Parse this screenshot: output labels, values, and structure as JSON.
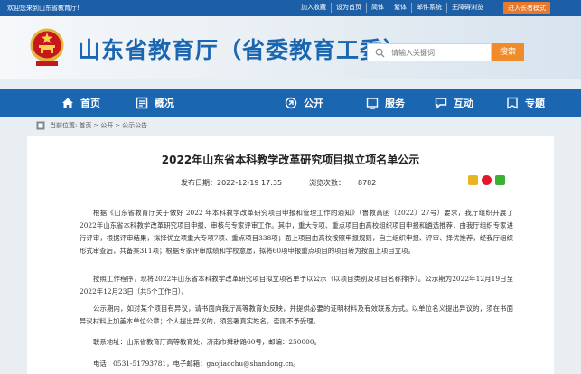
{
  "topbar": {
    "welcome": "欢迎您来到山东省教育厅!",
    "links": [
      "加入收藏",
      "设为首页",
      "简体",
      "繁体",
      "邮件系统",
      "无障碍浏览"
    ],
    "elder_mode": "进入长者模式"
  },
  "header": {
    "title": "山东省教育厅（省委教育工委）",
    "search_placeholder": "请输入关键词",
    "search_button": "搜索"
  },
  "nav": {
    "items": [
      {
        "label": "首页",
        "icon": "home-icon"
      },
      {
        "label": "概况",
        "icon": "overview-icon"
      },
      {
        "label": "公开",
        "icon": "open-icon"
      },
      {
        "label": "服务",
        "icon": "service-icon"
      },
      {
        "label": "互动",
        "icon": "interaction-icon"
      },
      {
        "label": "专题",
        "icon": "topic-icon"
      }
    ]
  },
  "breadcrumb": {
    "prefix": "当前位置:",
    "items": [
      "首页",
      "公开",
      "公示公告"
    ],
    "separator": ">"
  },
  "article": {
    "title": "2022年山东省本科教学改革研究项目拟立项名单公示",
    "publish_label": "发布日期：",
    "publish_date": "2022-12-19 17:35",
    "views_label": "浏览次数：",
    "views": "8782",
    "paragraphs": [
      "根据《山东省教育厅关于做好 2022 年本科教学改革研究项目申报和管理工作的通知》（鲁教高函〔2022〕27号）要求，我厅组织开展了2022年山东省本科教学改革研究项目申报、审核与专家评审工作。其中，重大专项、重点项目由高校组织项目申报和遴选推荐，由我厅组织专家进行评审，根据评审结果，拟择优立项重大专项7项、重点项目338项；面上项目由高校按照申报规则，自主组织申报、评审、择优推荐，经我厅组织形式审查后，共备案311项；根据专家评审成绩和学校意愿，拟将60项申报重点项目的项目转为按面上项目立项。",
      "按照工作程序，现将2022年山东省本科教学改革研究项目拟立项名单予以公示（以项目类别及项目名称排序）。公示期为2022年12月19日至2022年12月23日（共5个工作日）。",
      "公示期内，如对某个项目有异议，请书面向我厅高等教育处反映，并提供必要的证明材料及有效联系方式。以单位名义提出异议的，须在书面异议材料上加盖本单位公章；个人提出异议的，须签署真实姓名，否则不予受理。",
      "联系地址：山东省教育厅高等教育处，济南市舜耕路60号，邮编：250000。",
      "电话：0531-51793781，电子邮箱：gaojiaochu@shandong.cn。"
    ]
  },
  "colors": {
    "topbar": "#1d5fa7",
    "nav": "#1b66b1",
    "title_blue": "#1b66b1",
    "accent_orange": "#f08b2c",
    "elder_button": "#e8782c"
  }
}
